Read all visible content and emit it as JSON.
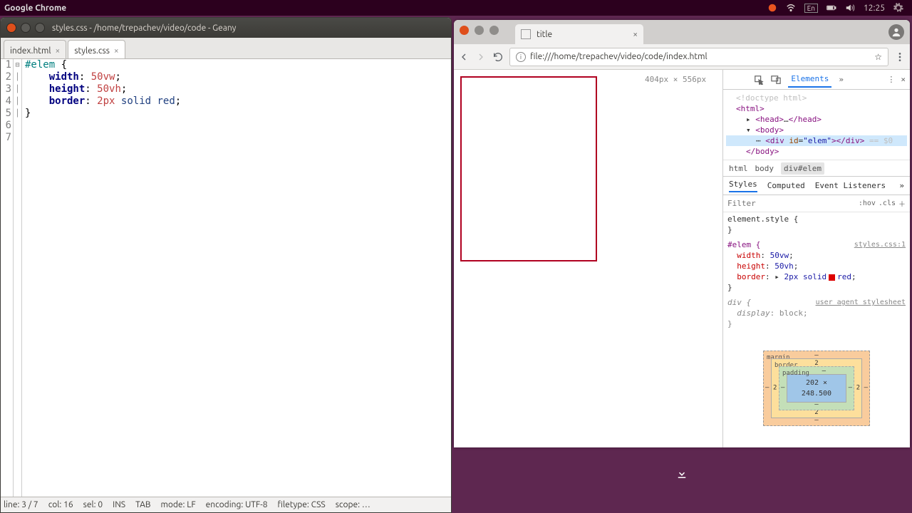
{
  "panel": {
    "title": "Google Chrome",
    "lang": "En",
    "clock": "12:25"
  },
  "geany": {
    "title": "styles.css - /home/trepachev/video/code - Geany",
    "tabs": [
      {
        "label": "index.html",
        "active": false
      },
      {
        "label": "styles.css",
        "active": true
      }
    ],
    "code": [
      {
        "n": "1",
        "html": "<span class='tok-sel'>#elem</span> <span class='tok-punc'>{</span>"
      },
      {
        "n": "2",
        "html": "    <span class='tok-prop'>width</span><span class='tok-punc'>:</span> <span class='tok-num'>50vw</span><span class='tok-punc'>;</span>"
      },
      {
        "n": "3",
        "html": "    <span class='tok-prop'>height</span><span class='tok-punc'>:</span> <span class='tok-num'>50vh</span><span class='tok-punc'>;</span>"
      },
      {
        "n": "4",
        "html": "    <span class='tok-prop'>border</span><span class='tok-punc'>:</span> <span class='tok-num'>2px</span> <span class='tok-val'>solid</span> <span class='tok-val'>red</span><span class='tok-punc'>;</span>"
      },
      {
        "n": "5",
        "html": "<span class='tok-punc'>}</span>"
      },
      {
        "n": "6",
        "html": ""
      },
      {
        "n": "7",
        "html": ""
      }
    ],
    "status": {
      "line": "line: 3 / 7",
      "col": "col: 16",
      "sel": "sel: 0",
      "ins": "INS",
      "tab": "TAB",
      "mode": "mode: LF",
      "enc": "encoding: UTF-8",
      "ftype": "filetype: CSS",
      "scope": "scope: …"
    }
  },
  "chrome": {
    "tab_title": "title",
    "url": "file:///home/trepachev/video/code/index.html",
    "devtools": {
      "viewport": "404px × 556px",
      "main_tab": "Elements",
      "dom": {
        "doctype": "<!doctype html>",
        "html_open": "<html>",
        "head": "<head>…</head>",
        "body_open": "<body>",
        "elem": "<div id=\"elem\"></div>",
        "selected_suffix": " == $0",
        "body_close": "</body>"
      },
      "crumbs": [
        "html",
        "body",
        "div#elem"
      ],
      "subtabs": [
        "Styles",
        "Computed",
        "Event Listeners"
      ],
      "filter_placeholder": "Filter",
      "hov": ":hov",
      "cls": ".cls",
      "rules": {
        "inline": "element.style {",
        "elem_sel": "#elem {",
        "elem_src": "styles.css:1",
        "width": "width: 50vw;",
        "height": "height: 50vh;",
        "border_k": "border:",
        "border_v1": "2px solid",
        "border_v2": "red;",
        "ua_sel": "div {",
        "ua_src": "user agent stylesheet",
        "display": "display: block;"
      },
      "box": {
        "margin": "margin",
        "border": "border",
        "padding": "padding",
        "content": "202 × 248.500",
        "b": "2",
        "dash": "–"
      }
    }
  }
}
